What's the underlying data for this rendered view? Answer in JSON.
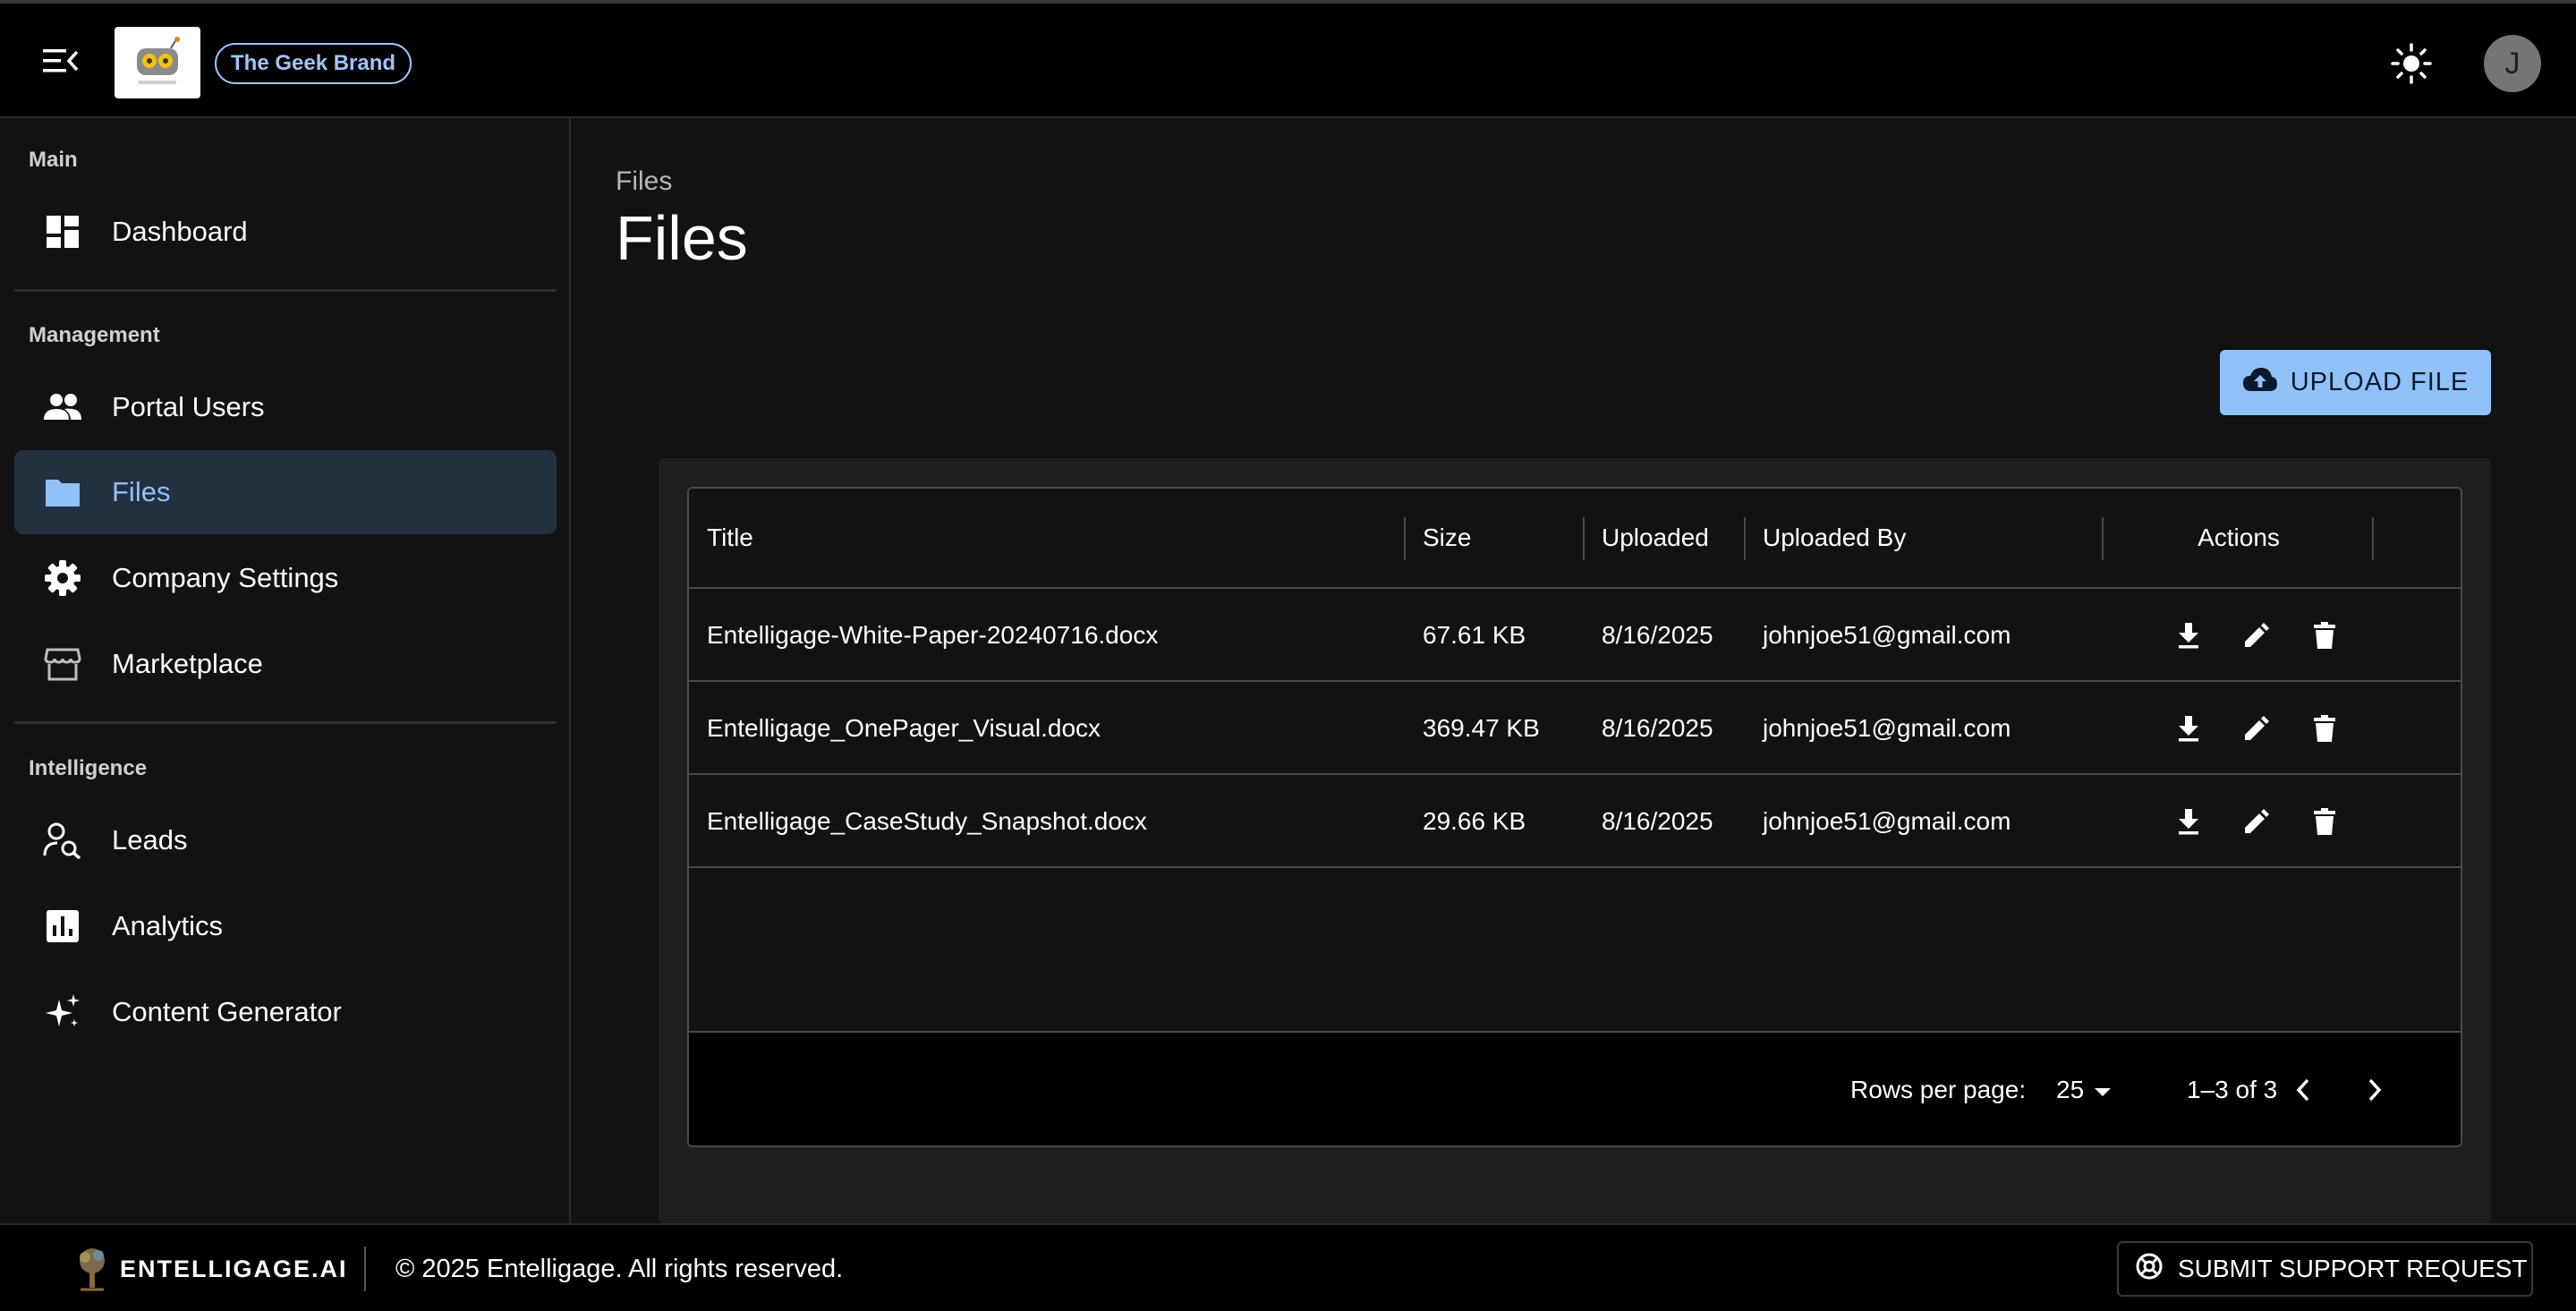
{
  "header": {
    "brand_chip": "The Geek Brand"
  },
  "user": {
    "initial": "J"
  },
  "sidebar": {
    "sections": [
      {
        "label": "Main"
      },
      {
        "label": "Management"
      },
      {
        "label": "Intelligence"
      }
    ],
    "items": [
      {
        "label": "Dashboard",
        "icon": "dashboard-icon"
      },
      {
        "label": "Portal Users",
        "icon": "people-icon"
      },
      {
        "label": "Files",
        "icon": "folder-icon",
        "active": true
      },
      {
        "label": "Company Settings",
        "icon": "gear-icon"
      },
      {
        "label": "Marketplace",
        "icon": "storefront-icon"
      },
      {
        "label": "Leads",
        "icon": "person-search-icon"
      },
      {
        "label": "Analytics",
        "icon": "bar-chart-icon"
      },
      {
        "label": "Content Generator",
        "icon": "sparkle-icon"
      }
    ]
  },
  "main": {
    "breadcrumb": "Files",
    "title": "Files",
    "upload_label": "UPLOAD FILE"
  },
  "table": {
    "columns": [
      "Title",
      "Size",
      "Uploaded",
      "Uploaded By",
      "Actions"
    ],
    "rows": [
      {
        "title": "Entelligage-White-Paper-20240716.docx",
        "size": "67.61 KB",
        "uploaded": "8/16/2025",
        "uploaded_by": "johnjoe51@gmail.com"
      },
      {
        "title": "Entelligage_OnePager_Visual.docx",
        "size": "369.47 KB",
        "uploaded": "8/16/2025",
        "uploaded_by": "johnjoe51@gmail.com"
      },
      {
        "title": "Entelligage_CaseStudy_Snapshot.docx",
        "size": "29.66 KB",
        "uploaded": "8/16/2025",
        "uploaded_by": "johnjoe51@gmail.com"
      }
    ],
    "pagination": {
      "rows_per_page_label": "Rows per page:",
      "rows_per_page_value": "25",
      "range": "1–3 of 3"
    }
  },
  "footer": {
    "brand": "ENTELLIGAGE.AI",
    "copyright": "© 2025 Entelligage. All rights reserved.",
    "support_label": "SUBMIT SUPPORT REQUEST"
  },
  "colors": {
    "accent": "#90c2f9",
    "background": "#121212",
    "active_nav_bg": "#233040"
  }
}
